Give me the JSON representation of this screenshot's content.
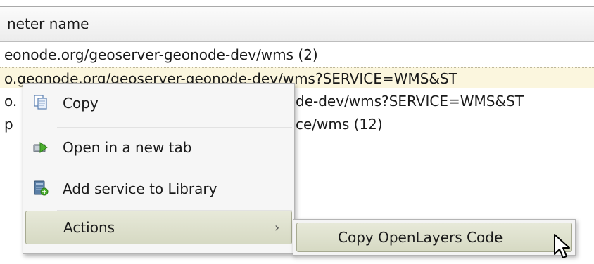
{
  "table": {
    "column_header": "neter name",
    "rows": [
      "eonode.org/geoserver-geonode-dev/wms (2)",
      "o.geonode.org/geoserver-geonode-dev/wms?SERVICE=WMS&ST",
      "o.",
      "de-dev/wms?SERVICE=WMS&ST",
      "p",
      "ce/wms (12)"
    ]
  },
  "context_menu": {
    "items": [
      {
        "label": "Copy",
        "icon": "copy-icon"
      },
      {
        "label": "Open in a new tab",
        "icon": "new-tab-icon"
      },
      {
        "label": "Add service to Library",
        "icon": "library-add-icon"
      },
      {
        "label": "Actions",
        "icon": "chevron-right-icon",
        "chevron": "›"
      }
    ]
  },
  "submenu": {
    "items": [
      {
        "label": "Copy OpenLayers Code"
      }
    ]
  },
  "colors": {
    "selection": "#fbf6de",
    "highlight": "#dcdfca",
    "menu_bg": "#f6f6f6"
  }
}
